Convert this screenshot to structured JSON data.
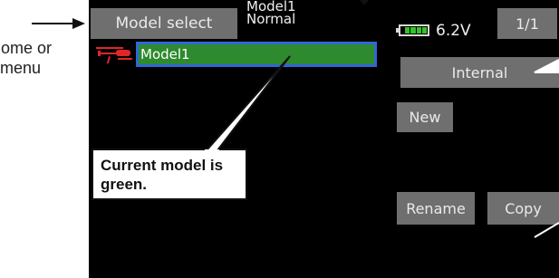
{
  "annotations": {
    "left_line1": "Home or",
    "left_line2": "menu",
    "callout": "Current model is green."
  },
  "header": {
    "title": "Model select",
    "model_name": "Model1",
    "model_mode": "Normal",
    "voltage": "6.2V",
    "page": "1/1"
  },
  "model_list": [
    {
      "name": "Model1",
      "icon": "helicopter-icon"
    }
  ],
  "buttons": {
    "internal": "Internal",
    "new": "New",
    "rename": "Rename",
    "copy": "Copy"
  },
  "colors": {
    "selected_row": "#2e8a2e",
    "selection_border": "#2f67d8",
    "button_gray": "#6f6f6f",
    "battery": "#35c22b"
  }
}
